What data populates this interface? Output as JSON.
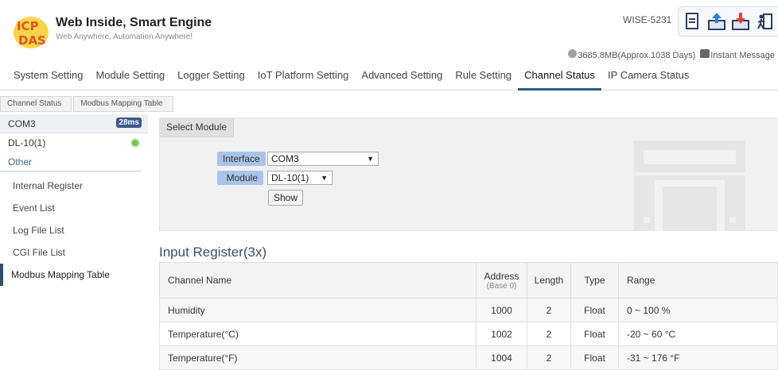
{
  "header": {
    "brand": "Web Inside, Smart Engine",
    "slogan": "Web Anywhere, Automation Anywhere!",
    "model": "WISE-5231",
    "storage": "3685.8MB(Approx.1038 Days)",
    "instant_message": "Instant Message",
    "toolbar_icons": [
      "document-icon",
      "upload-icon",
      "download-icon",
      "logout-icon"
    ]
  },
  "nav": {
    "items": [
      "System Setting",
      "Module Setting",
      "Logger Setting",
      "IoT Platform Setting",
      "Advanced Setting",
      "Rule Setting",
      "Channel Status",
      "IP Camera Status"
    ],
    "active": "Channel Status"
  },
  "breadcrumb": [
    "Channel Status",
    "Modbus Mapping Table"
  ],
  "sidebar": {
    "com": "COM3",
    "com_badge": "28ms",
    "module": "DL-10(1)",
    "other": "Other",
    "links": [
      "Internal Register",
      "Event List",
      "Log File List",
      "CGI File List",
      "Modbus Mapping Table"
    ],
    "active_link": "Modbus Mapping Table"
  },
  "select_module": {
    "title": "Select Module",
    "interface_label": "Interface",
    "interface_value": "COM3",
    "module_label": "Module",
    "module_value": "DL-10(1)",
    "show_button": "Show"
  },
  "table": {
    "title": "Input Register(3x)",
    "headers": {
      "channel_name": "Channel Name",
      "address": "Address",
      "address_sub": "(Base 0)",
      "length": "Length",
      "type": "Type",
      "range": "Range"
    },
    "rows": [
      {
        "name": "Humidity",
        "address": "1000",
        "length": "2",
        "type": "Float",
        "range": "0 ~ 100 %"
      },
      {
        "name": "Temperature(°C)",
        "address": "1002",
        "length": "2",
        "type": "Float",
        "range": "-20 ~ 60 °C"
      },
      {
        "name": "Temperature(°F)",
        "address": "1004",
        "length": "2",
        "type": "Float",
        "range": "-31 ~ 176 °F"
      }
    ]
  },
  "colors": {
    "accent": "#2d5d8f",
    "label_bg": "#a9c4e8",
    "badge": "#3c5a8a",
    "status_ok": "#6ec84a"
  }
}
